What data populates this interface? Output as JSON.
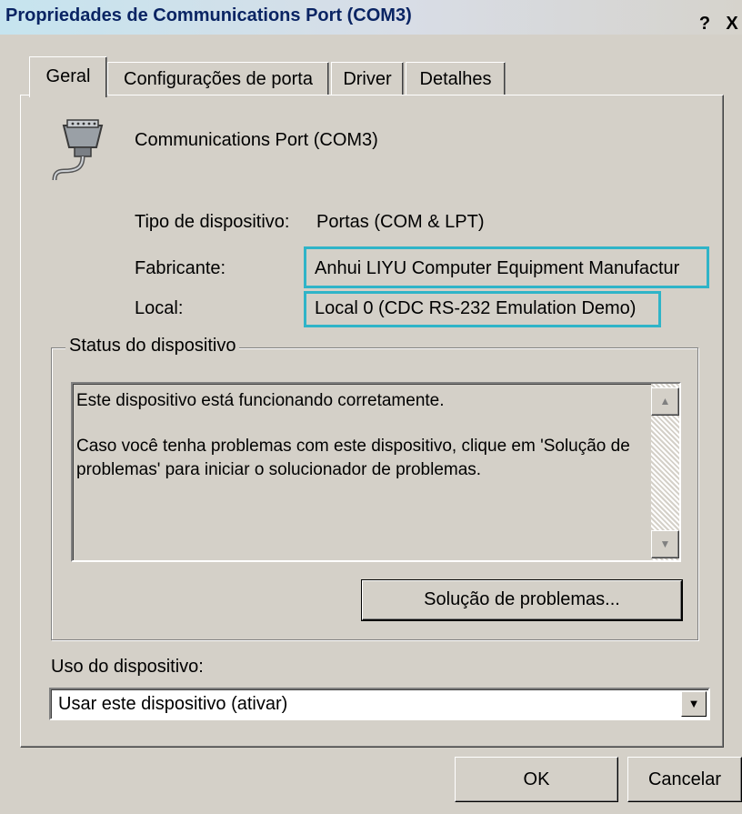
{
  "window": {
    "title": "Propriedades de Communications Port (COM3)",
    "help_label": "?",
    "close_label": "X"
  },
  "tabs": [
    {
      "label": "Geral",
      "active": true
    },
    {
      "label": "Configurações de porta",
      "active": false
    },
    {
      "label": "Driver",
      "active": false
    },
    {
      "label": "Detalhes",
      "active": false
    }
  ],
  "device": {
    "icon": "serial-port-icon",
    "name": "Communications Port (COM3)",
    "type_label": "Tipo de dispositivo:",
    "type_value": "Portas (COM & LPT)",
    "manufacturer_label": "Fabricante:",
    "manufacturer_value": "Anhui LIYU Computer Equipment Manufactur",
    "location_label": "Local:",
    "location_value": "Local 0 (CDC RS-232 Emulation Demo)"
  },
  "status": {
    "group_label": "Status do dispositivo",
    "line1": "Este dispositivo está funcionando corretamente.",
    "line2": "Caso você tenha problemas com este dispositivo, clique em 'Solução de problemas' para iniciar o solucionador de problemas.",
    "troubleshoot_label": "Solução de problemas..."
  },
  "usage": {
    "label": "Uso do dispositivo:",
    "selected": "Usar este dispositivo (ativar)"
  },
  "footer": {
    "ok_label": "OK",
    "cancel_label": "Cancelar"
  },
  "colors": {
    "highlight": "#2fb4c8",
    "title_text": "#0a2463",
    "dialog_bg": "#d4d0c8"
  }
}
